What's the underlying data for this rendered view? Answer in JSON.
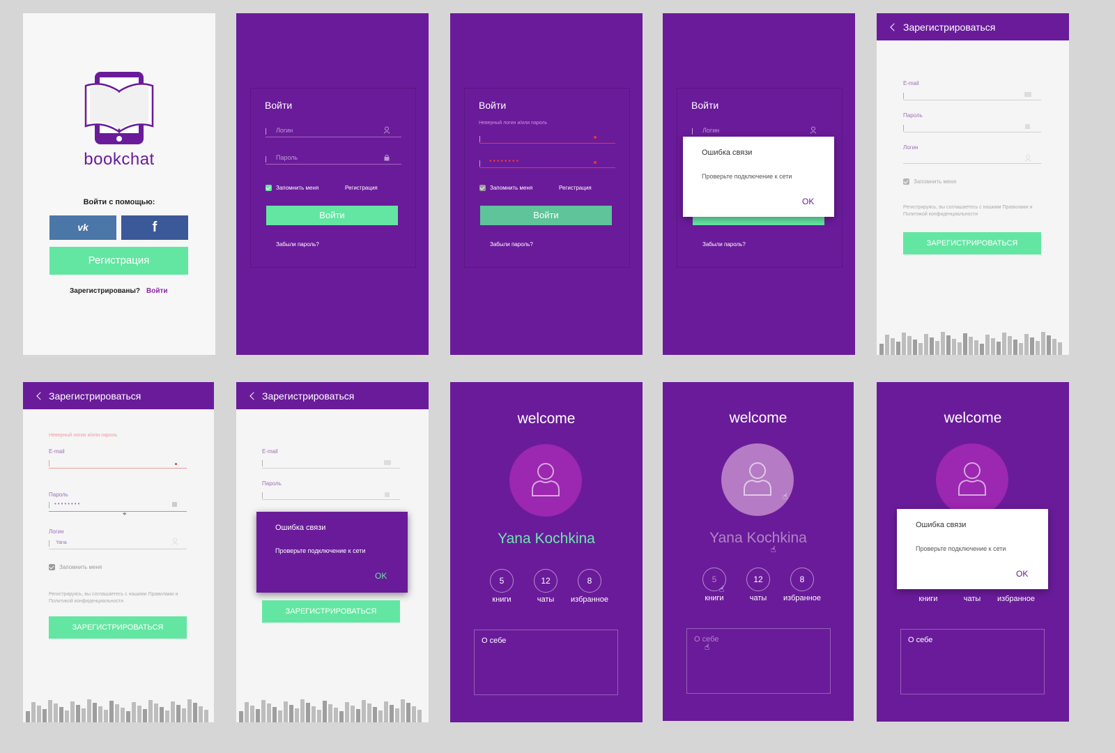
{
  "colors": {
    "purple": "#6a1b9a",
    "green": "#63e6a2",
    "error": "#e53935",
    "avatar": "#9c27b0",
    "name": "#6de6b0"
  },
  "s1": {
    "logo_text": "bookchat",
    "login_with": "Войти с помощью:",
    "vk_label": "VK",
    "fb_label": "f",
    "register_button": "Регистрация",
    "registered_q": "Зарегистрированы?",
    "login_link": "Войти"
  },
  "login": {
    "title": "Войти",
    "login_placeholder": "Логин",
    "password_placeholder": "Пароль",
    "remember": "Запомнить меня",
    "register_link": "Регистрация",
    "submit": "Войти",
    "forgot": "Забыли пароль?",
    "error": "Неверный логин и/или пароль",
    "password_dots": "••••••••"
  },
  "dialog": {
    "title": "Ошибка связи",
    "body": "Проверьте подключение к сети",
    "ok": "OK"
  },
  "register": {
    "header": "Зарегистрироваться",
    "email_label": "E-mail",
    "password_label": "Пароль",
    "login_label": "Логин",
    "remember": "Запомнить меня",
    "terms": "Регистрируясь, вы соглашаетесь с нашими Правилами и Политикой конфиденциальности",
    "submit": "ЗАРЕГИСТРИРОВАТЬСЯ",
    "error": "Неверный логин и/или пароль",
    "password_dots": "••••••••",
    "login_value": "Yana"
  },
  "profile": {
    "welcome": "welcome",
    "name": "Yana Kochkina",
    "stats": [
      {
        "value": "5",
        "label": "книги"
      },
      {
        "value": "12",
        "label": "чаты"
      },
      {
        "value": "8",
        "label": "избранное"
      }
    ],
    "about": "О себе"
  }
}
